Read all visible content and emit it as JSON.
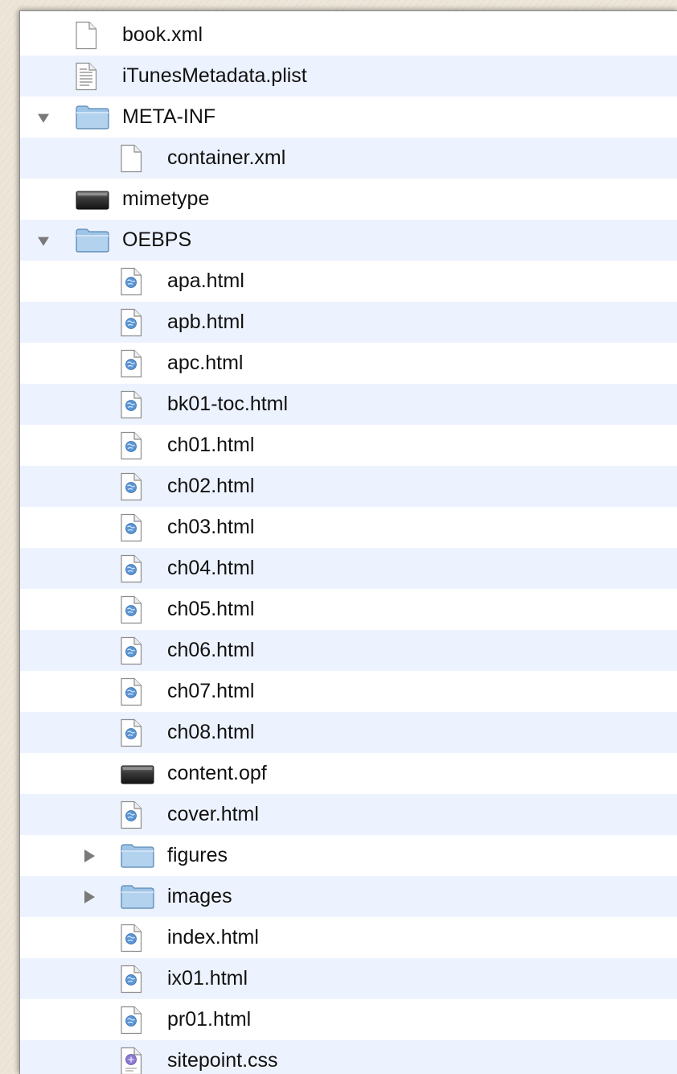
{
  "files": [
    {
      "name": "book.xml",
      "icon": "blank-document-icon"
    },
    {
      "name": "iTunesMetadata.plist",
      "icon": "text-document-icon"
    },
    {
      "name": "META-INF",
      "icon": "folder-icon",
      "expanded": true
    },
    {
      "name": "container.xml",
      "icon": "blank-document-icon"
    },
    {
      "name": "mimetype",
      "icon": "executable-file-icon"
    },
    {
      "name": "OEBPS",
      "icon": "folder-icon",
      "expanded": true
    },
    {
      "name": "apa.html",
      "icon": "html-document-icon"
    },
    {
      "name": "apb.html",
      "icon": "html-document-icon"
    },
    {
      "name": "apc.html",
      "icon": "html-document-icon"
    },
    {
      "name": "bk01-toc.html",
      "icon": "html-document-icon"
    },
    {
      "name": "ch01.html",
      "icon": "html-document-icon"
    },
    {
      "name": "ch02.html",
      "icon": "html-document-icon"
    },
    {
      "name": "ch03.html",
      "icon": "html-document-icon"
    },
    {
      "name": "ch04.html",
      "icon": "html-document-icon"
    },
    {
      "name": "ch05.html",
      "icon": "html-document-icon"
    },
    {
      "name": "ch06.html",
      "icon": "html-document-icon"
    },
    {
      "name": "ch07.html",
      "icon": "html-document-icon"
    },
    {
      "name": "ch08.html",
      "icon": "html-document-icon"
    },
    {
      "name": "content.opf",
      "icon": "executable-file-icon"
    },
    {
      "name": "cover.html",
      "icon": "html-document-icon"
    },
    {
      "name": "figures",
      "icon": "folder-icon",
      "expanded": false
    },
    {
      "name": "images",
      "icon": "folder-icon",
      "expanded": false
    },
    {
      "name": "index.html",
      "icon": "html-document-icon"
    },
    {
      "name": "ix01.html",
      "icon": "html-document-icon"
    },
    {
      "name": "pr01.html",
      "icon": "html-document-icon"
    },
    {
      "name": "sitepoint.css",
      "icon": "css-document-icon"
    }
  ],
  "colors": {
    "stripe": "#edf3fe",
    "folder": "#9ec4e6",
    "text": "#111111",
    "disclosure": "#7a7a7a"
  }
}
